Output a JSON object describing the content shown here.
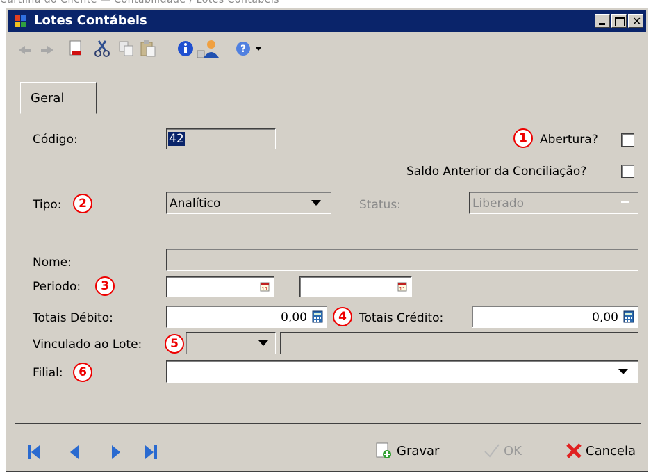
{
  "breadcrumb": "Cartilha do Cliente — Contabilidade / Lotes Contábeis",
  "window": {
    "title": "Lotes Contábeis"
  },
  "tabs": [
    {
      "label": "Geral"
    }
  ],
  "form": {
    "codigo": {
      "label": "Código:",
      "value": "42"
    },
    "abertura": {
      "label": "Abertura?",
      "checked": false
    },
    "saldo": {
      "label": "Saldo Anterior da Conciliação?",
      "checked": false
    },
    "tipo": {
      "label": "Tipo:",
      "value": "Analítico"
    },
    "status": {
      "label": "Status:",
      "value": "Liberado"
    },
    "nome": {
      "label": "Nome:",
      "value": ""
    },
    "periodo": {
      "label": "Periodo:",
      "start": "",
      "end": ""
    },
    "totais_debito": {
      "label": "Totais Débito:",
      "value": "0,00"
    },
    "totais_credito": {
      "label": "Totais Crédito:",
      "value": "0,00"
    },
    "vinculado": {
      "label": "Vinculado ao Lote:",
      "value": "",
      "desc": ""
    },
    "filial": {
      "label": "Filial:",
      "value": ""
    }
  },
  "markers": [
    "1",
    "2",
    "3",
    "4",
    "5",
    "6"
  ],
  "buttons": {
    "gravar": "Gravar",
    "ok": "OK",
    "cancela": "Cancela"
  },
  "icons": [
    "undo-icon",
    "redo-icon",
    "new-document-icon",
    "cut-icon",
    "copy-icon",
    "paste-icon",
    "info-icon",
    "user-icon",
    "help-icon"
  ]
}
